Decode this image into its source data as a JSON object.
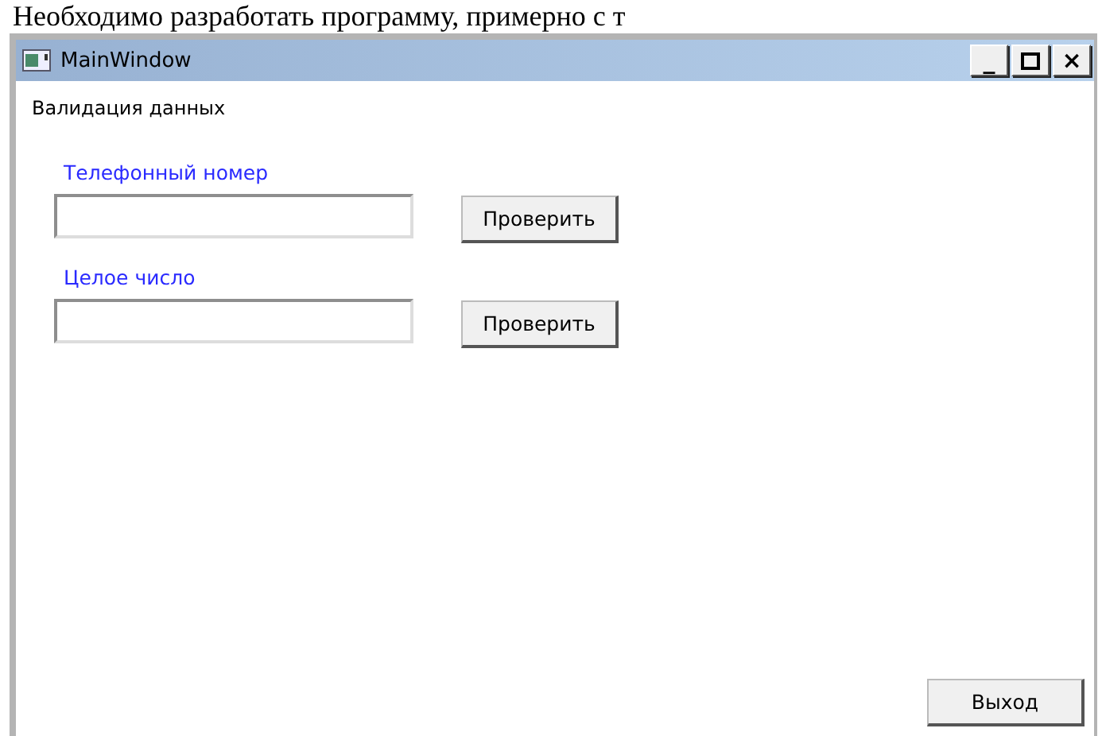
{
  "document_text": "Необходимо разработать программу, примерно с т",
  "window": {
    "title": "MainWindow",
    "minimize": "_",
    "close": "×"
  },
  "heading": "Валидация данных",
  "fields": [
    {
      "label": "Телефонный номер",
      "button": "Проверить"
    },
    {
      "label": "Целое число",
      "button": "Проверить"
    }
  ],
  "exit_button": "Выход"
}
